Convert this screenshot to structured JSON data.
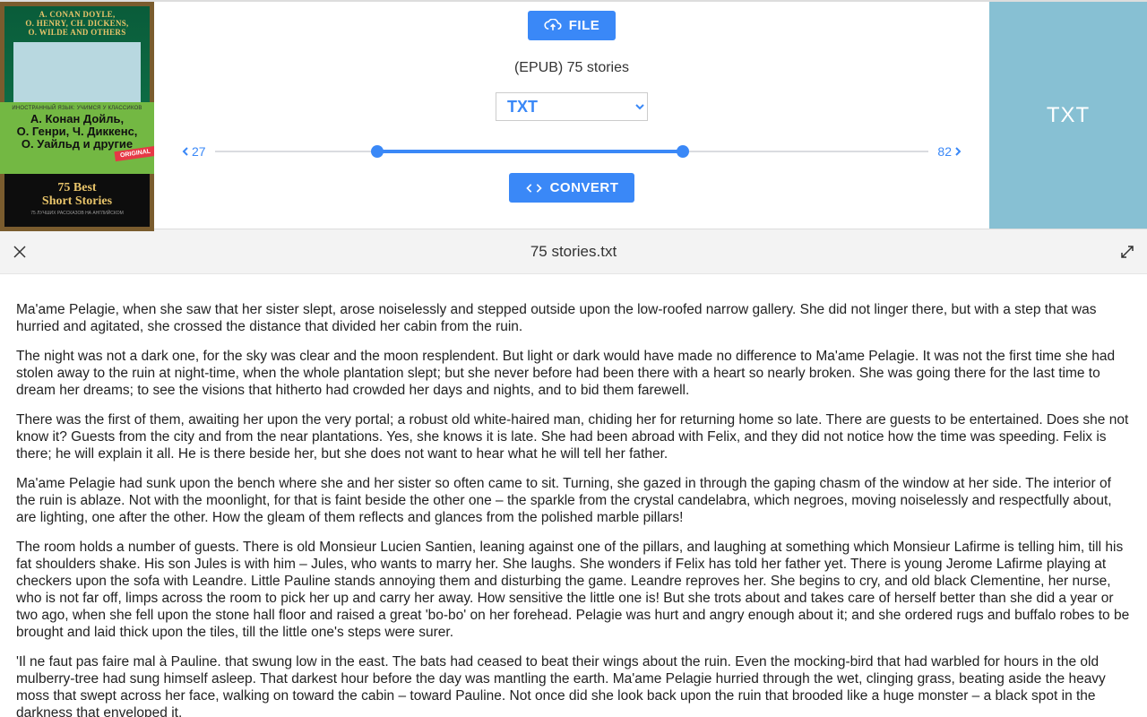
{
  "cover": {
    "authors_en": "A. Conan Doyle,\nO. Henry, Ch. Dickens,\nO. Wilde and others",
    "mid_small": "Иностранный язык: учимся у классиков",
    "authors_ru_l1": "А. Конан Дойль,",
    "authors_ru_l2": "О. Генри, Ч. Диккенс,",
    "authors_ru_l3": "О. Уайльд и другие",
    "original_badge": "ORIGINAL",
    "bot_title_l1": "75 Best",
    "bot_title_l2": "Short Stories",
    "bot_small": "75 лучших рассказов на английском"
  },
  "buttons": {
    "file": "FILE",
    "convert": "CONVERT"
  },
  "file_label": "(EPUB) 75 stories",
  "format_select": {
    "value": "TXT"
  },
  "slider": {
    "left": "27",
    "right": "82",
    "fill_left_pct": 22.8,
    "fill_right_pct": 65.6
  },
  "sidebox": "TXT",
  "result_filename": "75 stories.txt",
  "paragraphs": [
    "Ma'ame Pelagie, when she saw that her sister slept, arose noiselessly and stepped outside upon the low-roofed narrow gallery. She did not linger there, but with a step that was hurried and agitated, she crossed the distance that divided her cabin from the ruin.",
    "The night was not a dark one, for the sky was clear and the moon resplendent. But light or dark would have made no difference to Ma'ame Pelagie. It was not the first time she had stolen away to the ruin at night-time, when the whole plantation slept; but she never before had been there with a heart so nearly broken. She was going there for the last time to dream her dreams; to see the visions that hitherto had crowded her days and nights, and to bid them farewell.",
    "There was the first of them, awaiting her upon the very portal; a robust old white-haired man, chiding her for returning home so late. There are guests to be entertained. Does she not know it? Guests from the city and from the near plantations. Yes, she knows it is late. She had been abroad with Felix, and they did not notice how the time was speeding. Felix is there; he will explain it all. He is there beside her, but she does not want to hear what he will tell her father.",
    "Ma'ame Pelagie had sunk upon the bench where she and her sister so often came to sit. Turning, she gazed in through the gaping chasm of the window at her side. The interior of the ruin is ablaze. Not with the moonlight, for that is faint beside the other one – the sparkle from the crystal candelabra, which negroes, moving noiselessly and respectfully about, are lighting, one after the other. How the gleam of them reflects and glances from the polished marble pillars!",
    "The room holds a number of guests. There is old Monsieur Lucien Santien, leaning against one of the pillars, and laughing at something which Monsieur Lafirme is telling him, till his fat shoulders shake. His son Jules is with him – Jules, who wants to marry her. She laughs. She wonders if Felix has told her father yet. There is young Jerome Lafirme playing at checkers upon the sofa with Leandre. Little Pauline stands annoying them and disturbing the game. Leandre reproves her. She begins to cry, and old black Clementine, her nurse, who is not far off, limps across the room to pick her up and carry her away. How sensitive the little one is! But she trots about and takes care of herself better than she did a year or two ago, when she fell upon the stone hall floor and raised a great 'bo-bo' on her forehead. Pelagie was hurt and angry enough about it; and she ordered rugs and buffalo robes to be brought and laid thick upon the tiles, till the little one's steps were surer.",
    "'Il ne faut pas faire mal à Pauline. that swung low in the east. The bats had ceased to beat their wings about the ruin. Even the mocking-bird that had warbled for hours in the old mulberry-tree had sung himself asleep. That darkest hour before the day was mantling the earth. Ma'ame Pelagie hurried through the wet, clinging grass, beating aside the heavy moss that swept across her face, walking on toward the cabin – toward Pauline. Not once did she look back upon the ruin that brooded like a huge monster – a black spot in the darkness that enveloped it."
  ]
}
